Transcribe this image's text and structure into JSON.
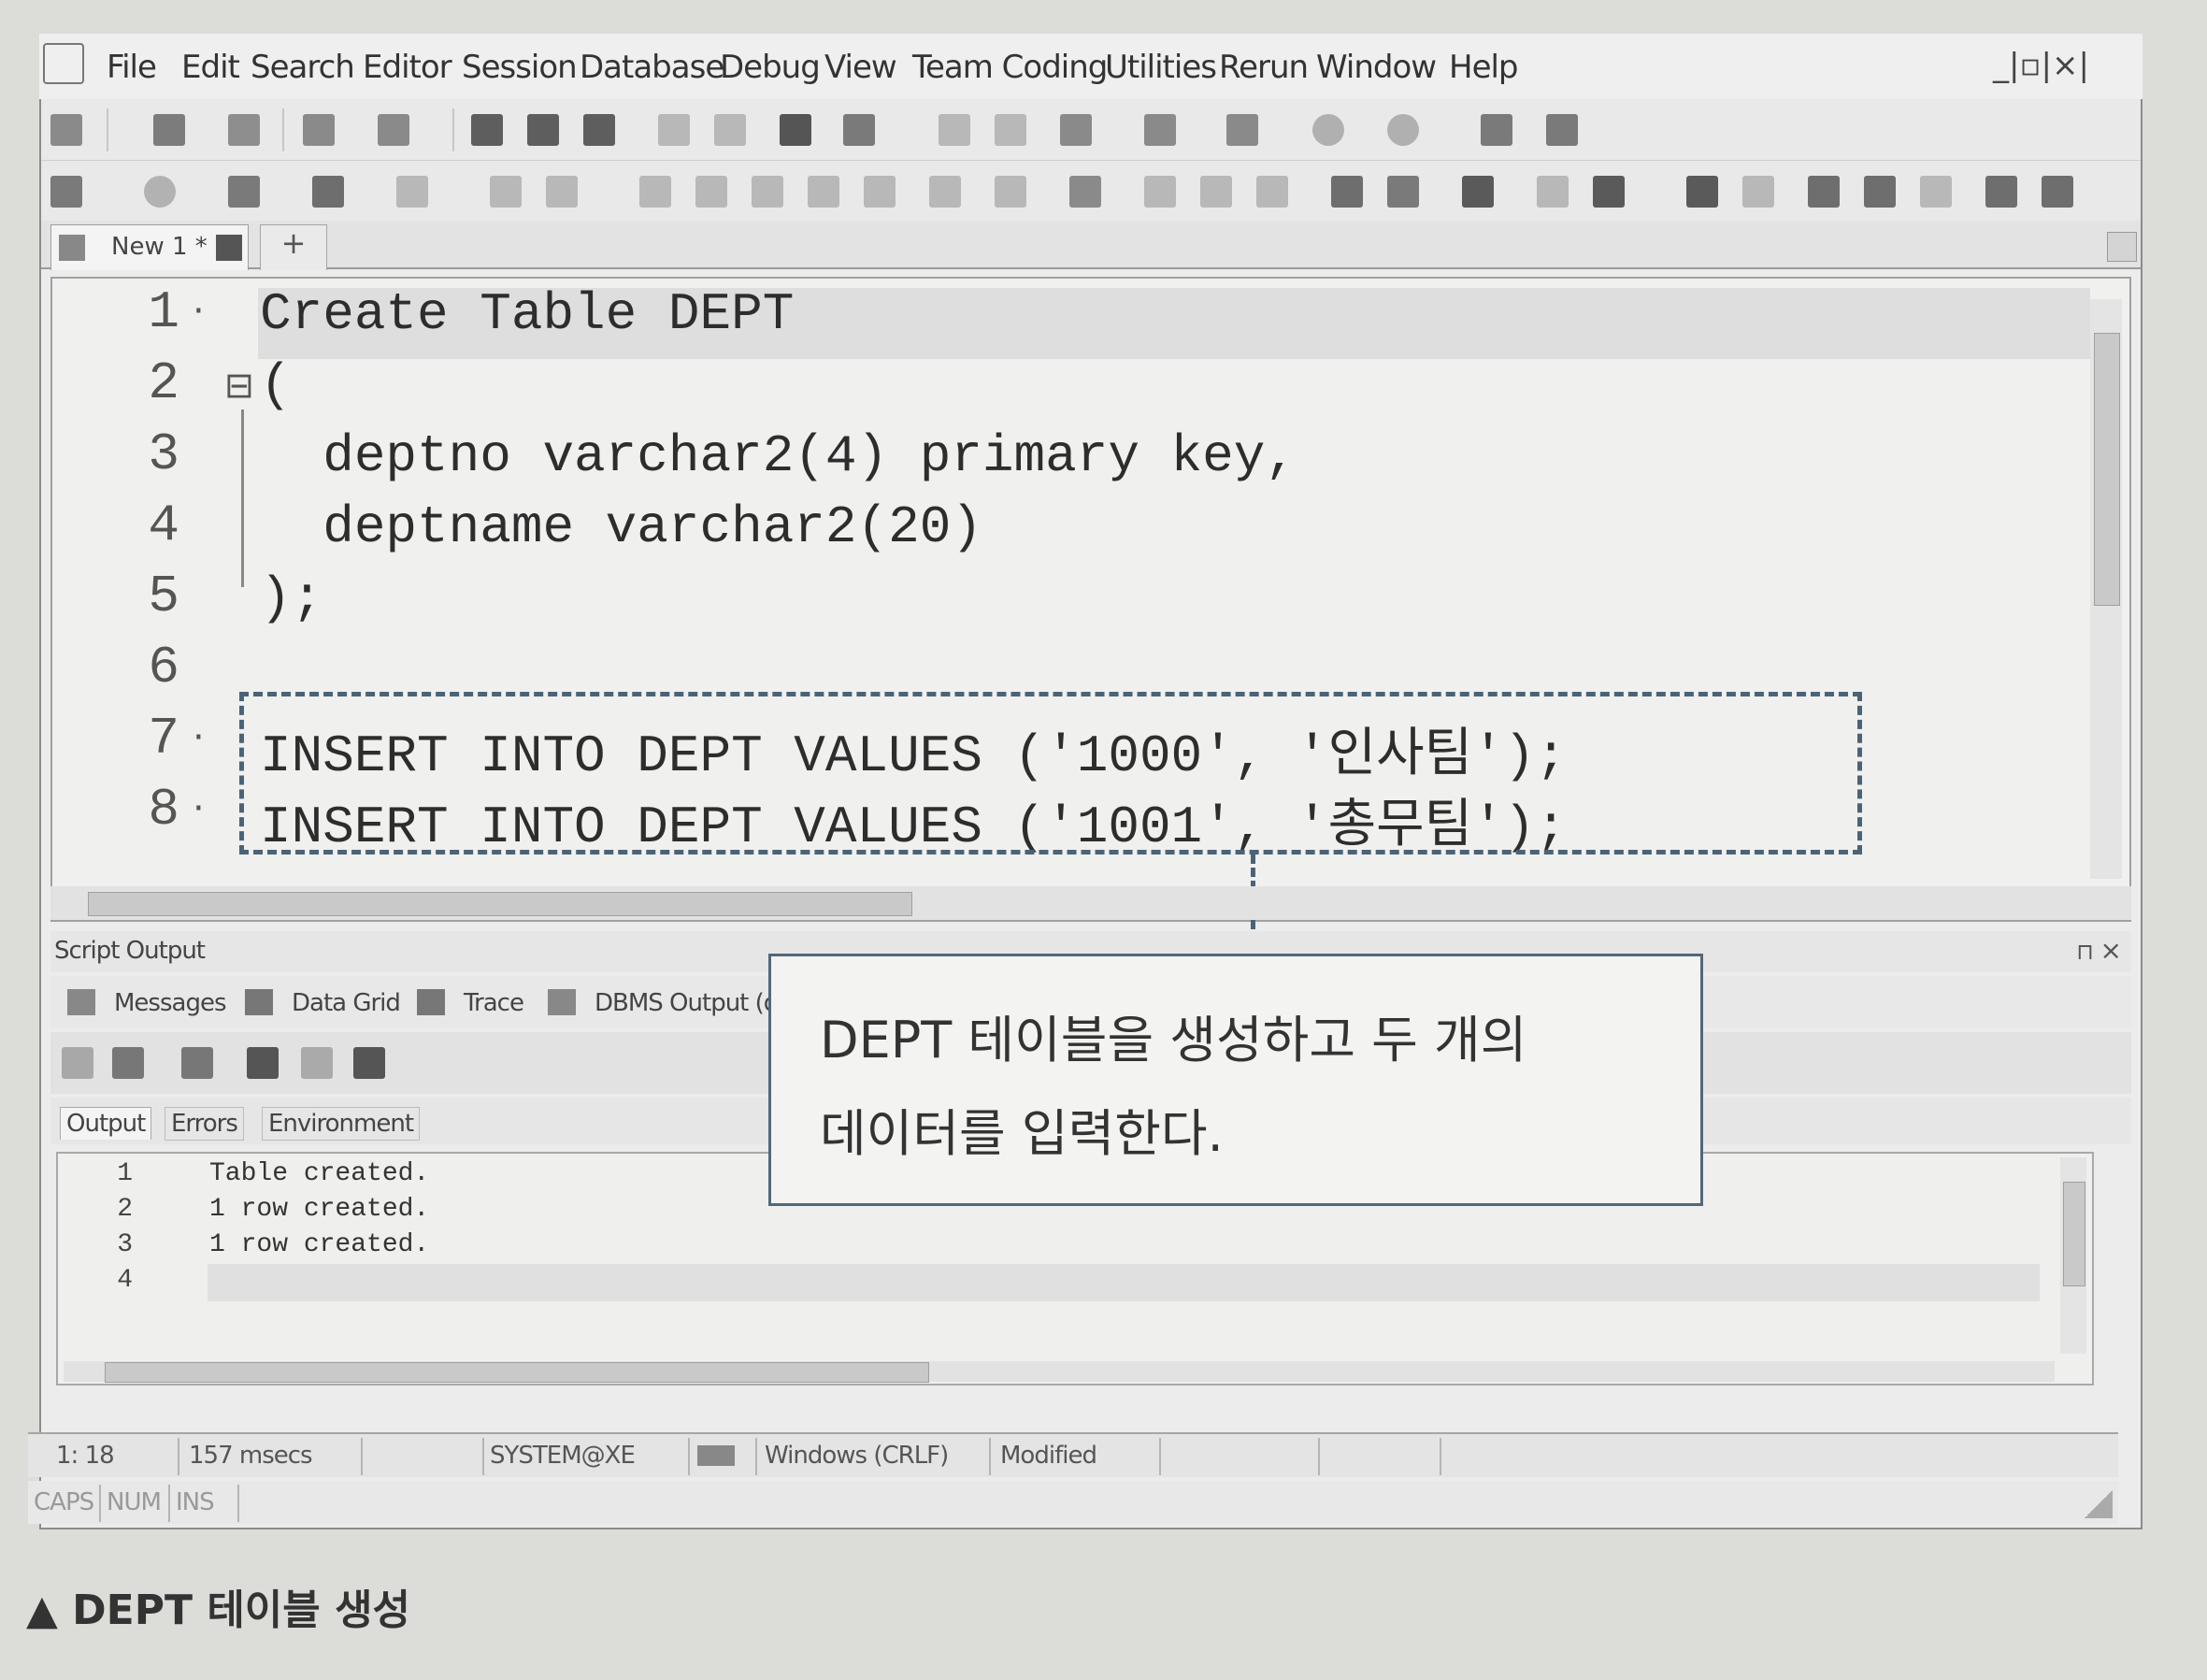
{
  "menubar": {
    "items": [
      "File",
      "Edit",
      "Search",
      "Editor",
      "Session",
      "Database",
      "Debug",
      "View",
      "Team Coding",
      "Utilities",
      "Rerun",
      "Window",
      "Help"
    ],
    "window_controls": "_|▫|×|"
  },
  "tabs": {
    "document_tab": "New 1 *",
    "add_tab": "+"
  },
  "editor": {
    "line_numbers": [
      "1",
      "2",
      "3",
      "4",
      "5",
      "6",
      "7",
      "8"
    ],
    "lines": [
      "Create Table DEPT",
      "(",
      "  deptno varchar2(4) primary key,",
      "  deptname varchar2(20)",
      ");",
      "",
      "INSERT INTO DEPT VALUES ('1000', '인사팀');",
      "INSERT INTO DEPT VALUES ('1001', '총무팀');"
    ],
    "fold_marker": "⊟"
  },
  "callout": {
    "line1": "DEPT 테이블을 생성하고 두 개의",
    "line2": "데이터를 입력한다."
  },
  "script_output": {
    "panel_title": "Script Output",
    "tabs": [
      "Messages",
      "Data Grid",
      "Trace",
      "DBMS Output (d"
    ],
    "sub_tabs": [
      "Output",
      "Errors",
      "Environment"
    ],
    "line_numbers": [
      "1",
      "2",
      "3",
      "4"
    ],
    "lines": [
      "Table created.",
      "1 row created.",
      "1 row created.",
      ""
    ]
  },
  "statusbar": {
    "position": "1: 18",
    "elapsed": "157 msecs",
    "connection": "SYSTEM@XE",
    "line_ending": "Windows (CRLF)",
    "state": "Modified",
    "caps": "CAPS",
    "num": "NUM",
    "ins": "INS"
  },
  "caption": "▲ DEPT 테이블 생성"
}
